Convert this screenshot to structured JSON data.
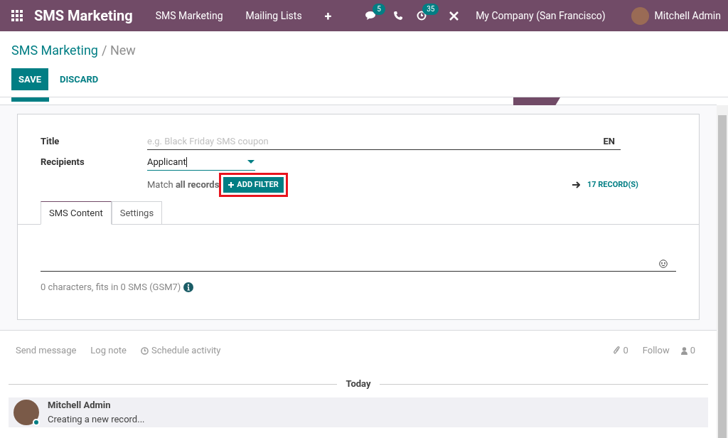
{
  "navbar": {
    "app_name": "SMS Marketing",
    "menu": [
      "SMS Marketing",
      "Mailing Lists",
      "+"
    ],
    "messages_count": "5",
    "activities_count": "35",
    "company": "My Company (San Francisco)",
    "user": "Mitchell Admin"
  },
  "breadcrumb": {
    "parent": "SMS Marketing",
    "separator": "/",
    "current": "New"
  },
  "buttons": {
    "save": "SAVE",
    "discard": "DISCARD"
  },
  "form": {
    "title_label": "Title",
    "title_placeholder": "e.g. Black Friday SMS coupon",
    "lang": "EN",
    "recipients_label": "Recipients",
    "recipients_value": "Applicant",
    "match_text": "Match **all records**",
    "add_filter": "ADD FILTER",
    "add_filter_highlighted": true,
    "records": "17 RECORD(S)",
    "tabs": [
      {
        "label": "SMS Content",
        "selected": true
      },
      {
        "label": "Settings",
        "selected": false
      }
    ],
    "char_info": "0 characters, fits in 0 SMS (GSM7)"
  },
  "chatter": {
    "actions": [
      "Send message",
      "Log note",
      "Schedule activity"
    ],
    "attachments": "0",
    "follow": "Follow",
    "followers": "0",
    "divider": "Today",
    "messages": [
      {
        "author": "Mitchell Admin",
        "body": "Creating a new record...",
        "online": true
      }
    ]
  }
}
